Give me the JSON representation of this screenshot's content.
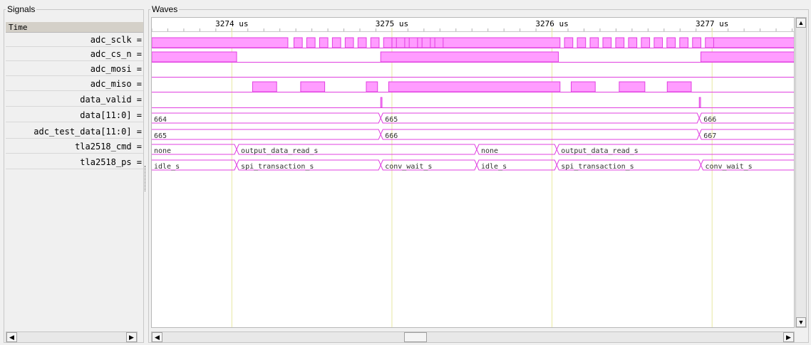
{
  "panels": {
    "signals_title": "Signals",
    "waves_title": "Waves"
  },
  "signal_list": {
    "header": "Time",
    "names": [
      "adc_sclk =",
      "adc_cs_n =",
      "adc_mosi =",
      "adc_miso =",
      "data_valid =",
      "data[11:0] =",
      "adc_test_data[11:0] =",
      "tla2518_cmd =",
      "tla2518_ps ="
    ]
  },
  "timeline": {
    "unit": "us",
    "ticks": [
      {
        "label": "3274 us",
        "t": 3274
      },
      {
        "label": "3275 us",
        "t": 3275
      },
      {
        "label": "3276 us",
        "t": 3276
      },
      {
        "label": "3277 us",
        "t": 3277
      }
    ],
    "range": [
      3273.5,
      3277.52
    ]
  },
  "waves": {
    "adc_sclk": {
      "idle_high": [
        [
          3273.5,
          3274.35
        ],
        [
          3275.0,
          3276.05
        ],
        [
          3276.99,
          3277.52
        ]
      ],
      "pulses_start": [
        3274.36,
        3276.05
      ],
      "pulse_count": 12,
      "period": 0.08
    },
    "adc_cs_n": {
      "high": [
        [
          3273.5,
          3274.03
        ],
        [
          3274.93,
          3276.04
        ],
        [
          3276.93,
          3277.52
        ]
      ]
    },
    "adc_mosi": {
      "high": []
    },
    "adc_miso": {
      "high": [
        [
          3274.13,
          3274.28
        ],
        [
          3274.43,
          3274.58
        ],
        [
          3274.84,
          3274.91
        ],
        [
          3274.98,
          3276.05
        ],
        [
          3276.12,
          3276.27
        ],
        [
          3276.42,
          3276.58
        ],
        [
          3276.72,
          3276.87
        ]
      ]
    },
    "data_valid": {
      "pulses": [
        3274.93,
        3276.92
      ]
    },
    "data": {
      "segments": [
        {
          "t": 3273.5,
          "value": "664"
        },
        {
          "t": 3274.93,
          "value": "665"
        },
        {
          "t": 3276.92,
          "value": "666"
        }
      ]
    },
    "adc_test_data": {
      "segments": [
        {
          "t": 3273.5,
          "value": "665"
        },
        {
          "t": 3274.93,
          "value": "666"
        },
        {
          "t": 3276.92,
          "value": "667"
        }
      ]
    },
    "tla2518_cmd": {
      "segments": [
        {
          "t": 3273.5,
          "value": "none"
        },
        {
          "t": 3274.03,
          "value": "output_data_read_s"
        },
        {
          "t": 3275.53,
          "value": "none"
        },
        {
          "t": 3276.03,
          "value": "output_data_read_s"
        }
      ]
    },
    "tla2518_ps": {
      "segments": [
        {
          "t": 3273.5,
          "value": "idle_s"
        },
        {
          "t": 3274.03,
          "value": "spi_transaction_s"
        },
        {
          "t": 3274.93,
          "value": "conv_wait_s"
        },
        {
          "t": 3275.53,
          "value": "idle_s"
        },
        {
          "t": 3276.03,
          "value": "spi_transaction_s"
        },
        {
          "t": 3276.93,
          "value": "conv_wait_s"
        }
      ]
    }
  },
  "colors": {
    "wave": "#e040e0",
    "fill": "#ff9cff",
    "cursor": "#e8e8a0",
    "label": "#303030"
  },
  "icons": {
    "left": "arrow-left-icon",
    "right": "arrow-right-icon",
    "up": "arrow-up-icon",
    "down": "arrow-down-icon"
  }
}
